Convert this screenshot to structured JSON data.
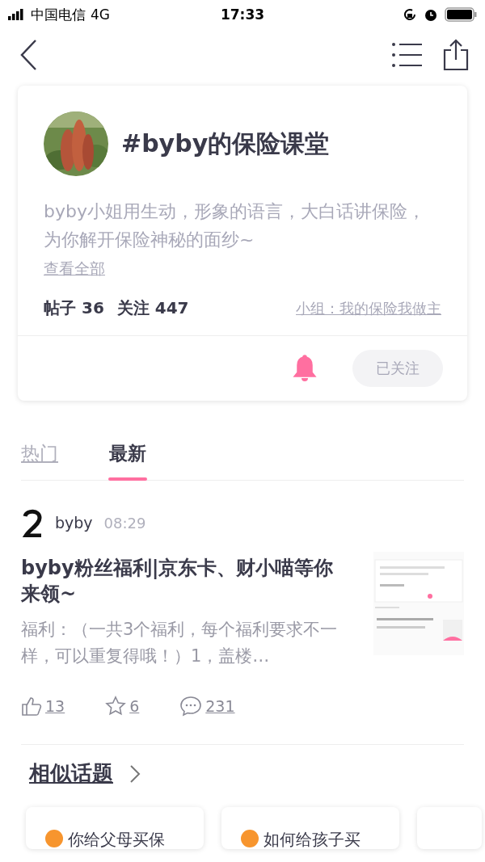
{
  "status_bar": {
    "carrier": "中国电信",
    "network": "4G",
    "time": "17:33"
  },
  "topic": {
    "title": "#byby的保险课堂",
    "description": "byby小姐用生动，形象的语言，大白话讲保险，为你解开保险神秘的面纱~",
    "more_link": "查看全部",
    "posts_label": "帖子 36",
    "followers_label": "关注 447",
    "group_link": "小组：我的保险我做主",
    "notify_on": true,
    "follow_button": "已关注",
    "followed": true
  },
  "tabs": [
    {
      "label": "热门",
      "selected": false
    },
    {
      "label": "最新",
      "selected": true
    }
  ],
  "posts": [
    {
      "author": "byby",
      "time": "08:29",
      "title": "byby粉丝福利|京东卡、财小喵等你来领~",
      "excerpt": "福利：（一共3个福利，每个福利要求不一样，可以重复得哦！）1，盖楼…",
      "likes": "13",
      "favorites": "6",
      "comments": "231"
    }
  ],
  "similar": {
    "heading": "相似话题",
    "cards": [
      {
        "title": "你给父母买保"
      },
      {
        "title": "如何给孩子买"
      }
    ]
  }
}
